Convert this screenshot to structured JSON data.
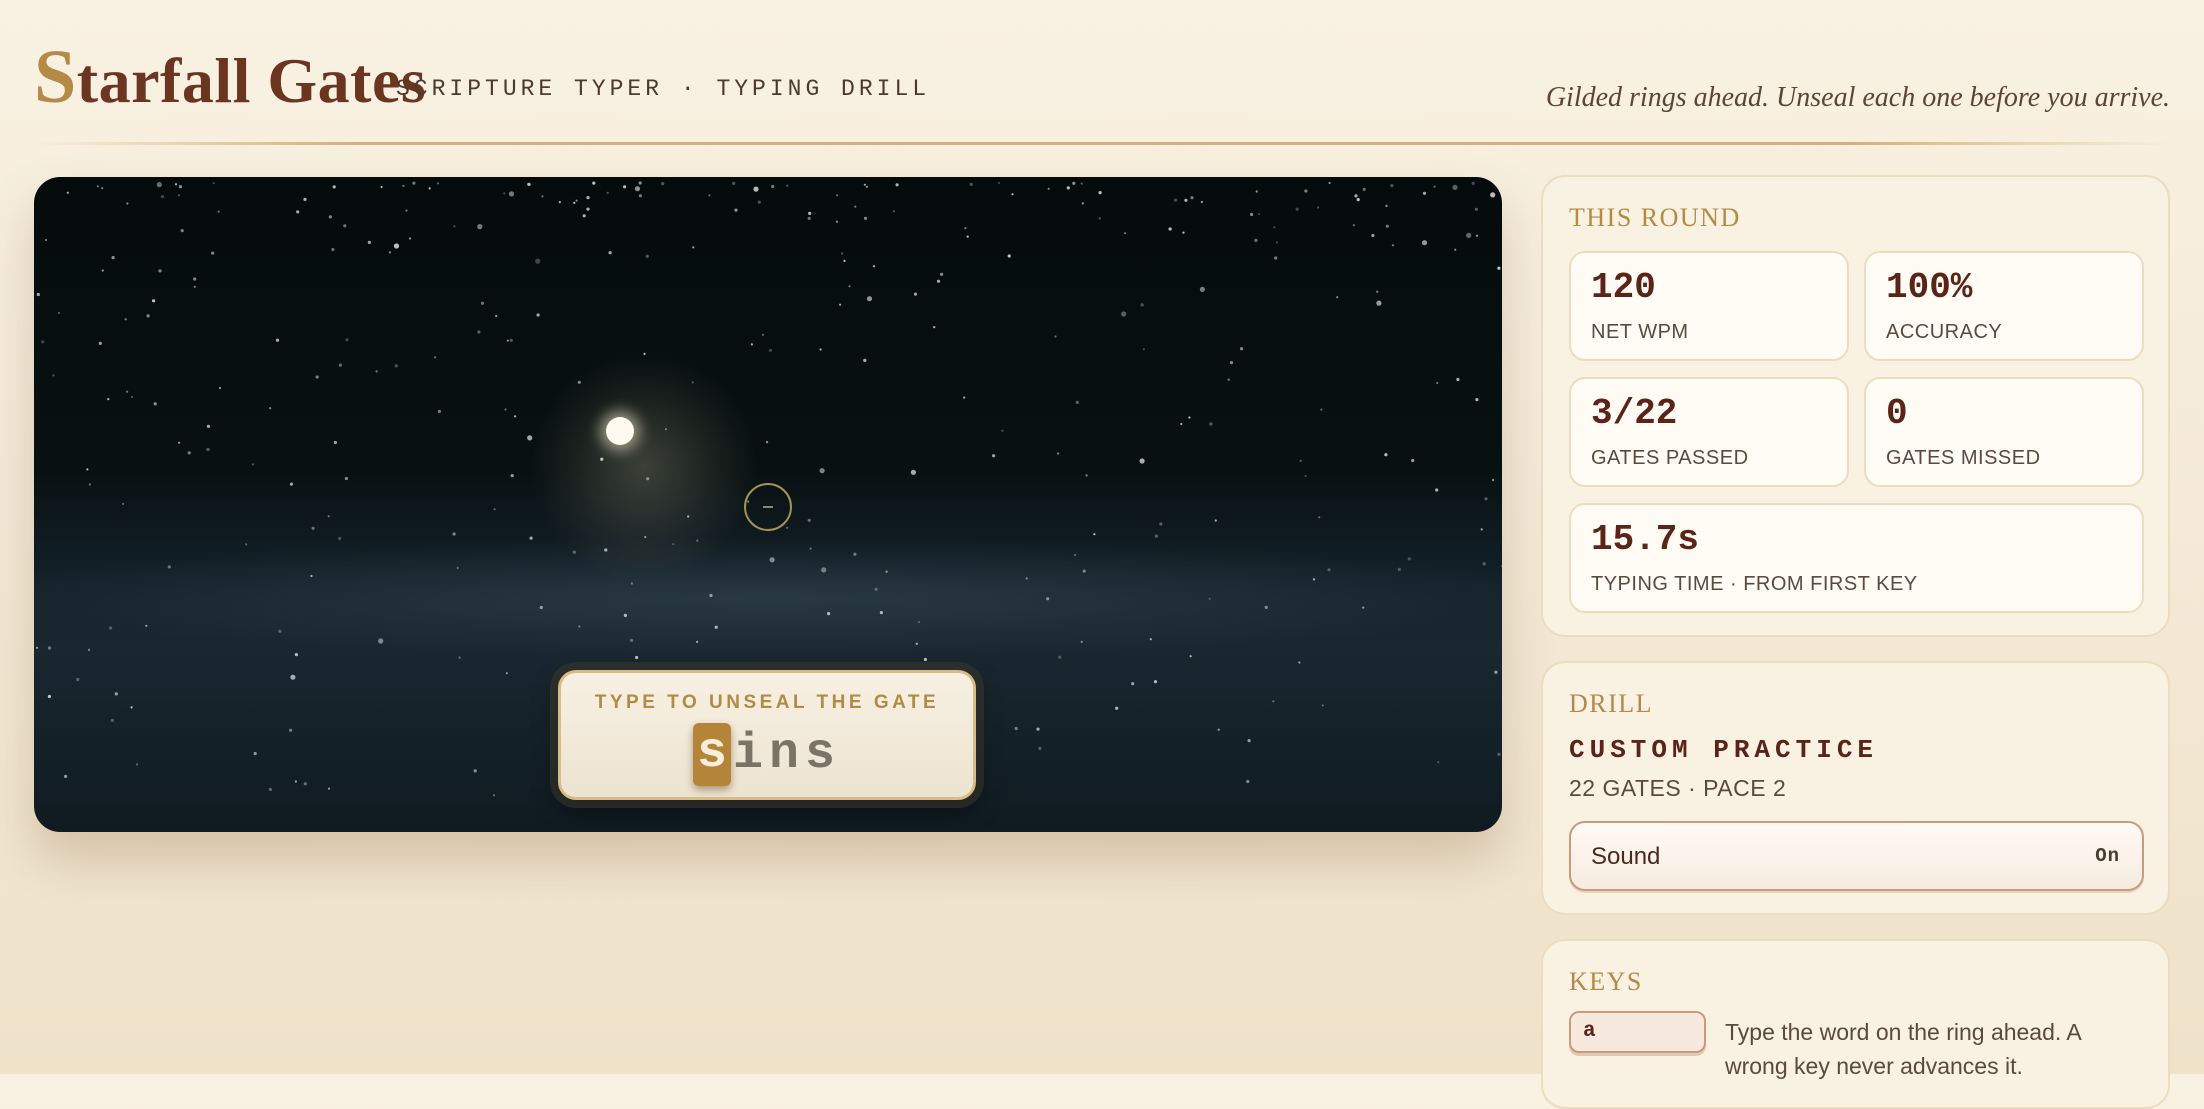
{
  "header": {
    "brand_cap": "S",
    "brand_rest": "tarfall Gates",
    "subtitle": "SCRIPTURE TYPER · TYPING DRILL",
    "tagline": "Gilded rings ahead. Unseal each one before you arrive."
  },
  "game": {
    "prompt_label": "TYPE TO UNSEAL THE GATE",
    "word_typed": "s",
    "word_rest": "ins"
  },
  "round": {
    "title": "THIS ROUND",
    "net_wpm": {
      "value": "120",
      "label": "NET WPM"
    },
    "accuracy": {
      "value": "100%",
      "label": "ACCURACY"
    },
    "gates_passed": {
      "value": "3/22",
      "label": "GATES PASSED"
    },
    "gates_missed": {
      "value": "0",
      "label": "GATES MISSED"
    },
    "typing_time": {
      "value": "15.7s",
      "label": "TYPING TIME · FROM FIRST KEY"
    }
  },
  "drill": {
    "title": "DRILL",
    "name": "CUSTOM PRACTICE",
    "meta": "22 GATES · PACE 2",
    "sound_label": "Sound",
    "sound_state": "On"
  },
  "keys": {
    "title": "KEYS",
    "key": "a",
    "description": "Type the word on the ring ahead. A wrong key never advances it."
  },
  "colors": {
    "accent_gold": "#b48a45",
    "brand_brown": "#6b3520",
    "sky_dark": "#050b0c"
  }
}
